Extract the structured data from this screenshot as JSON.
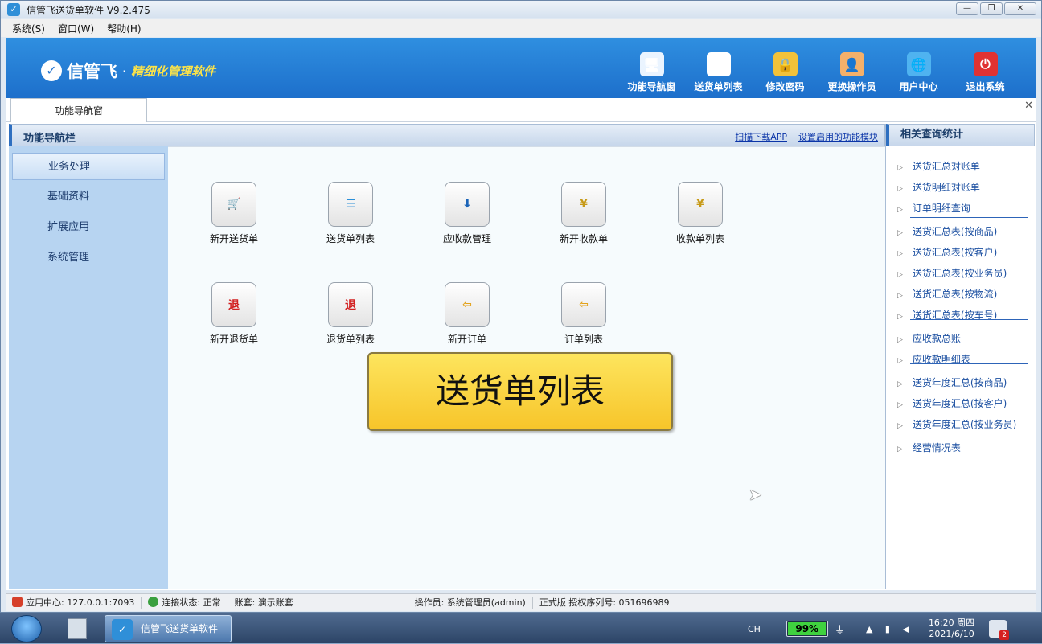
{
  "window": {
    "title": "信管飞送货单软件 V9.2.475",
    "min": "—",
    "max": "❐",
    "close": "✕"
  },
  "menu": [
    "系统(S)",
    "窗口(W)",
    "帮助(H)"
  ],
  "banner": {
    "logo_text": "信管飞",
    "dot": "·",
    "slogan": "精细化管理软件"
  },
  "toolbar": [
    {
      "label": "功能导航窗",
      "icon": "monitor-icon",
      "color": "#eaf4ff",
      "glyph": "🖥"
    },
    {
      "label": "送货单列表",
      "icon": "list-icon",
      "color": "#ffffff",
      "glyph": "☰"
    },
    {
      "label": "修改密码",
      "icon": "lock-icon",
      "color": "#f2c23a",
      "glyph": "🔒"
    },
    {
      "label": "更换操作员",
      "icon": "user-icon",
      "color": "#f4b06a",
      "glyph": "👤"
    },
    {
      "label": "用户中心",
      "icon": "globe-icon",
      "color": "#4fb3f0",
      "glyph": "🌐"
    },
    {
      "label": "退出系统",
      "icon": "power-icon",
      "color": "#e03232",
      "glyph": "⏻"
    }
  ],
  "tabs": {
    "active": "功能导航窗",
    "close": "✕"
  },
  "navbar": {
    "title": "功能导航栏",
    "link_app": "扫描下载APP",
    "link_modules": "设置启用的功能模块"
  },
  "sidebar": [
    "业务处理",
    "基础资料",
    "扩展应用",
    "系统管理"
  ],
  "functions": [
    {
      "label": "新开送货单",
      "icon": "cart-icon",
      "glyph": "🛒"
    },
    {
      "label": "送货单列表",
      "icon": "cart-list-icon",
      "glyph": "☰"
    },
    {
      "label": "应收款管理",
      "icon": "receivable-icon",
      "glyph": "⬇"
    },
    {
      "label": "新开收款单",
      "icon": "yen-note-icon",
      "glyph": "¥"
    },
    {
      "label": "收款单列表",
      "icon": "yen-list-icon",
      "glyph": "¥"
    },
    {
      "label": "新开退货单",
      "icon": "return-note-icon",
      "glyph": "退"
    },
    {
      "label": "退货单列表",
      "icon": "return-list-icon",
      "glyph": "退"
    },
    {
      "label": "新开订单",
      "icon": "order-note-icon",
      "glyph": "⇦"
    },
    {
      "label": "订单列表",
      "icon": "order-list-icon",
      "glyph": "⇦"
    }
  ],
  "tooltip": "送货单列表",
  "right_panel": {
    "title": "相关查询统计",
    "items": [
      "送货汇总对账单",
      "送货明细对账单",
      "订单明细查询",
      "送货汇总表(按商品)",
      "送货汇总表(按客户)",
      "送货汇总表(按业务员)",
      "送货汇总表(按物流)",
      "送货汇总表(按车号)",
      "应收款总账",
      "应收款明细表",
      "送货年度汇总(按商品)",
      "送货年度汇总(按客户)",
      "送货年度汇总(按业务员)",
      "经营情况表"
    ]
  },
  "status": {
    "center": "应用中心: 127.0.0.1:7093",
    "connection": "连接状态: 正常",
    "account": "账套: 演示账套",
    "operator": "操作员: 系统管理员(admin)",
    "license": "正式版 授权序列号: 051696989"
  },
  "taskbar": {
    "app": "信管飞送货单软件",
    "ime": "CH",
    "battery": "99%",
    "battery_level": 0.99,
    "time": "16:20 周四",
    "date": "2021/6/10",
    "notifications": "2"
  },
  "colors": {
    "banner": "#1d6fcb",
    "slogan": "#fbe34a",
    "sidebar": "#b7d4f1",
    "tooltip": "#f7c52a",
    "link": "#0b35a8"
  }
}
